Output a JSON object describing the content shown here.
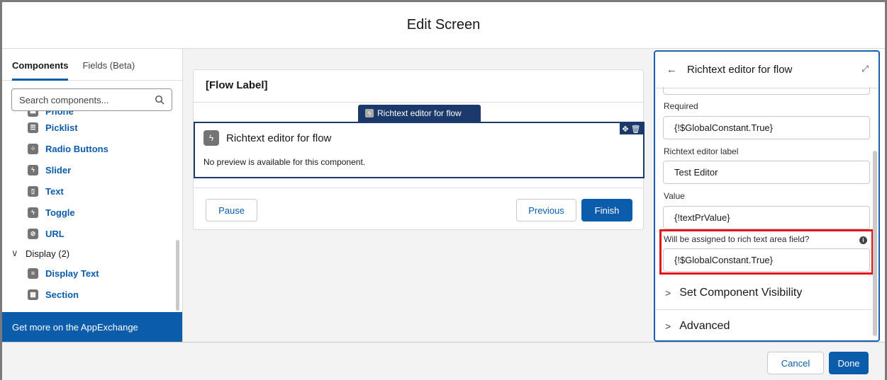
{
  "modal": {
    "title": "Edit Screen",
    "cancel_label": "Cancel",
    "done_label": "Done"
  },
  "left_panel": {
    "tabs": [
      {
        "label": "Components",
        "active": true
      },
      {
        "label": "Fields (Beta)",
        "active": false
      }
    ],
    "search_placeholder": "Search components...",
    "items_top": [
      {
        "label": "Phone",
        "icon": "phone-icon"
      },
      {
        "label": "Picklist",
        "icon": "list-icon"
      },
      {
        "label": "Radio Buttons",
        "icon": "radio-icon"
      },
      {
        "label": "Slider",
        "icon": "bolt-icon"
      },
      {
        "label": "Text",
        "icon": "text-field-icon"
      },
      {
        "label": "Toggle",
        "icon": "bolt-icon"
      },
      {
        "label": "URL",
        "icon": "link-icon"
      }
    ],
    "display_group": "Display (2)",
    "items_display": [
      {
        "label": "Display Text",
        "icon": "text-block-icon"
      },
      {
        "label": "Section",
        "icon": "section-icon"
      }
    ],
    "appexchange_label": "Get more on the AppExchange"
  },
  "canvas": {
    "flow_label": "[Flow Label]",
    "component_tag": "Richtext editor for flow",
    "component_title": "Richtext editor for flow",
    "component_message": "No preview is available for this component.",
    "pause_label": "Pause",
    "previous_label": "Previous",
    "finish_label": "Finish"
  },
  "right_panel": {
    "title": "Richtext editor for flow",
    "fields": [
      {
        "label": "Required",
        "value": "{!$GlobalConstant.True}"
      },
      {
        "label": "Richtext editor label",
        "value": "Test Editor"
      },
      {
        "label": "Value",
        "value": "{!textPrValue}"
      },
      {
        "label": "Will be assigned to rich text area field?",
        "value": "{!$GlobalConstant.True}"
      }
    ],
    "sections": [
      "Set Component Visibility",
      "Advanced"
    ]
  },
  "colors": {
    "brand": "#0b5cab",
    "component_outline": "#1b3a6b",
    "highlight": "#e4141b"
  }
}
